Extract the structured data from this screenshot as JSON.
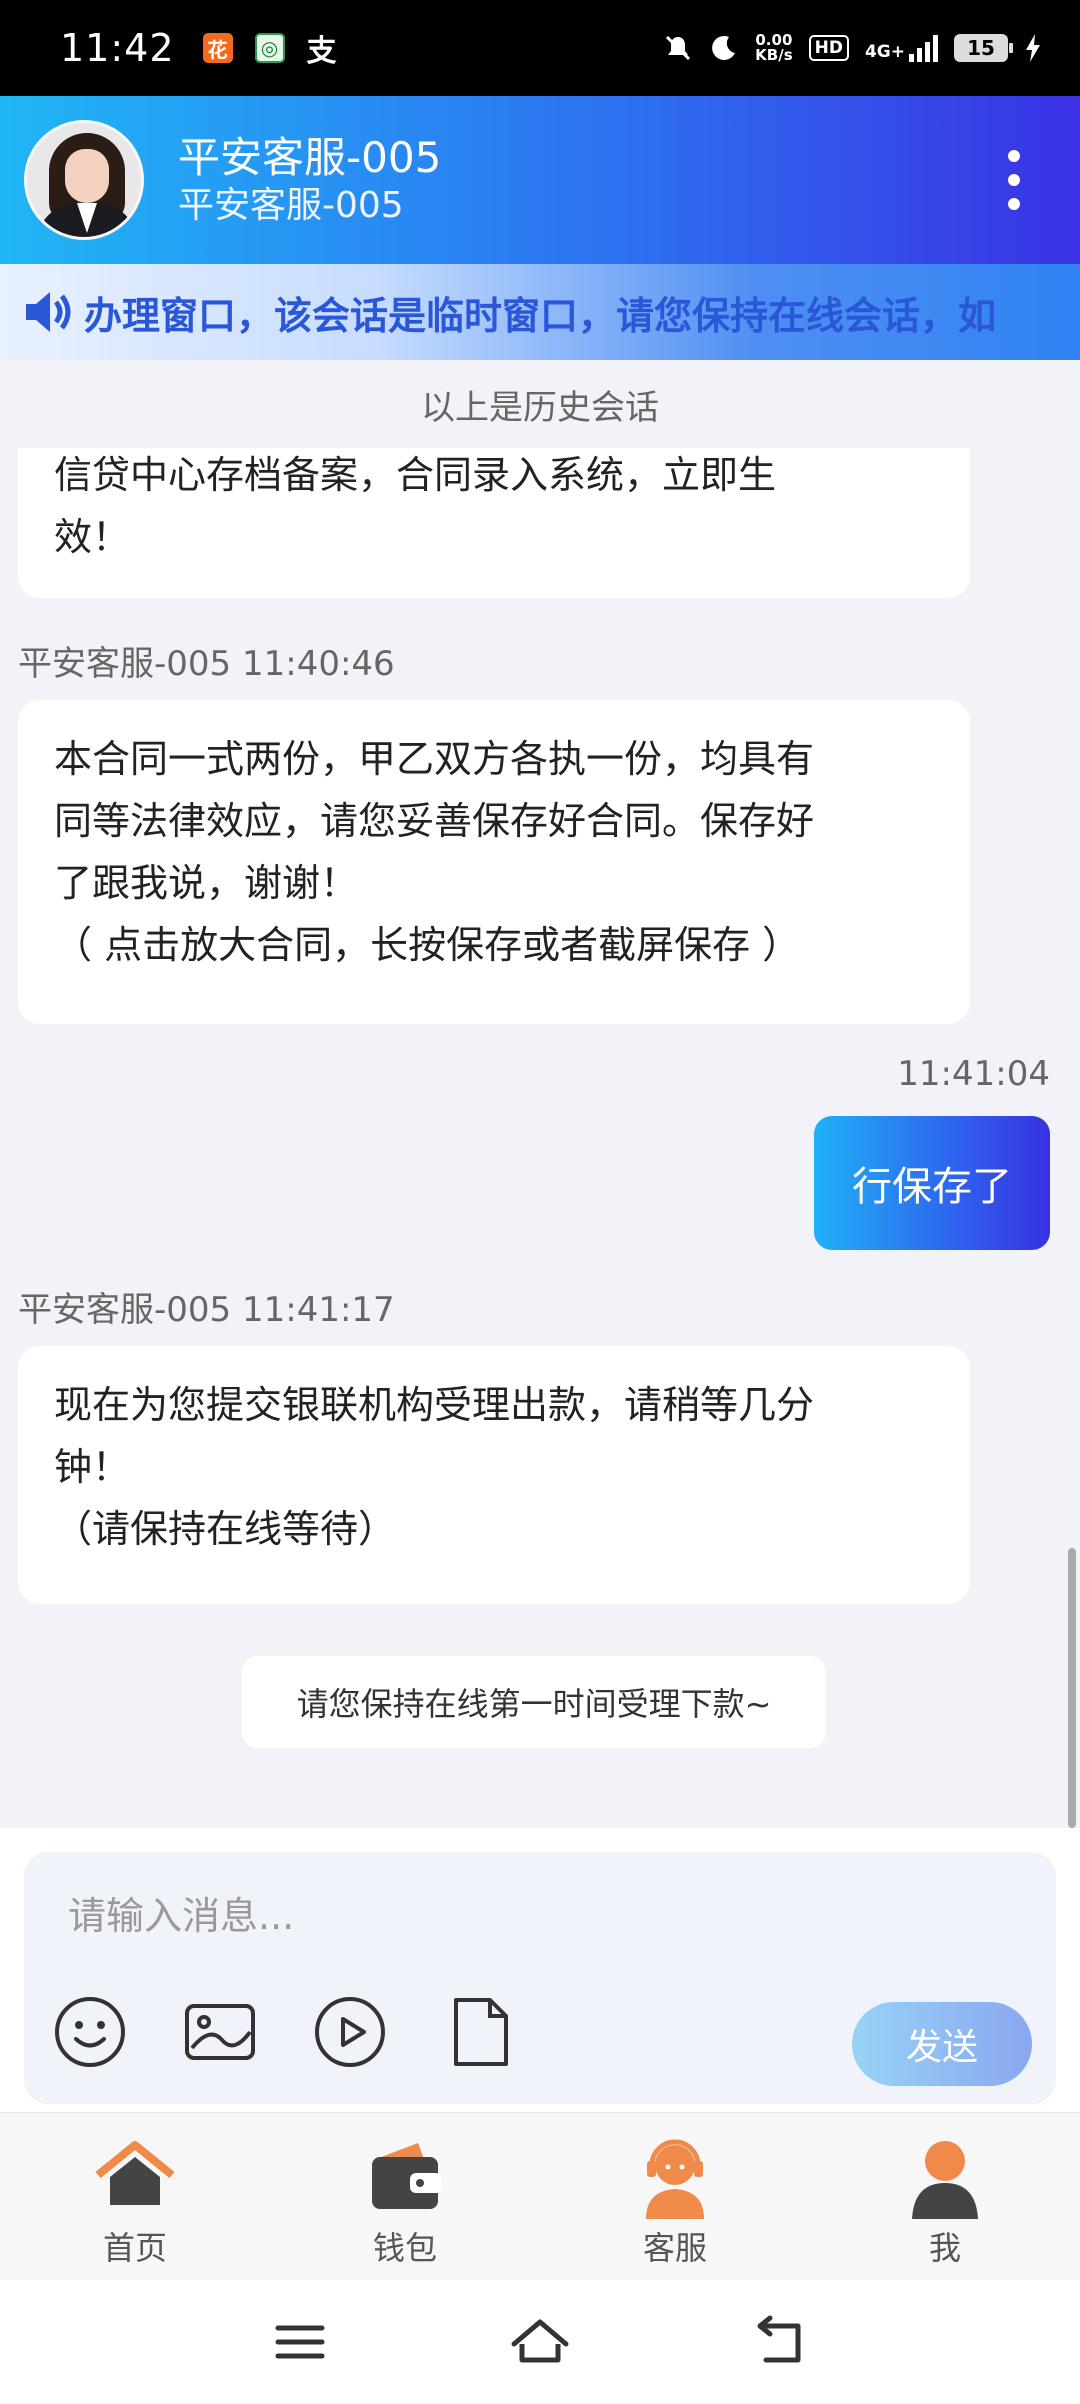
{
  "status_bar": {
    "time": "11:42",
    "app_icons": [
      "花",
      "◎",
      "支"
    ],
    "net_speed_value": "0.00",
    "net_speed_unit": "KB/s",
    "hd_label": "HD",
    "network_label": "4G+",
    "battery_level": "15"
  },
  "header": {
    "title": "平安客服-005",
    "subtitle": "平安客服-005"
  },
  "notice": {
    "text": "办理窗口，该会话是临时窗口，请您保持在线会话，如"
  },
  "history_divider": "以上是历史会话",
  "messages": [
    {
      "type": "incoming",
      "sender_time": "",
      "lines": [
        "信贷中心存档备案，合同录入系统，立即生",
        "效！"
      ]
    },
    {
      "type": "incoming",
      "sender_time": "平安客服-005 11:40:46",
      "lines": [
        "本合同一式两份，甲乙双方各执一份，均具有",
        "同等法律效应，请您妥善保存好合同。保存好",
        "了跟我说，谢谢！",
        "（ 点击放大合同，长按保存或者截屏保存 ）"
      ]
    },
    {
      "type": "outgoing",
      "time": "11:41:04",
      "text": "行保存了"
    },
    {
      "type": "incoming",
      "sender_time": "平安客服-005 11:41:17",
      "lines": [
        "现在为您提交银联机构受理出款，请稍等几分",
        "钟！",
        "（请保持在线等待）"
      ]
    }
  ],
  "system_tip": "请您保持在线第一时间受理下款~",
  "composer": {
    "placeholder": "请输入消息...",
    "send_label": "发送",
    "tools": [
      "emoji-icon",
      "image-icon",
      "video-icon",
      "file-icon"
    ]
  },
  "bottom_nav": [
    {
      "label": "首页",
      "icon": "home-icon"
    },
    {
      "label": "钱包",
      "icon": "wallet-icon"
    },
    {
      "label": "客服",
      "icon": "customer-service-icon"
    },
    {
      "label": "我",
      "icon": "profile-icon"
    }
  ],
  "colors": {
    "header_gradient_start": "#20b6f5",
    "header_gradient_end": "#3a32e4",
    "accent_orange": "#f08a4b",
    "nav_dark": "#444444"
  }
}
